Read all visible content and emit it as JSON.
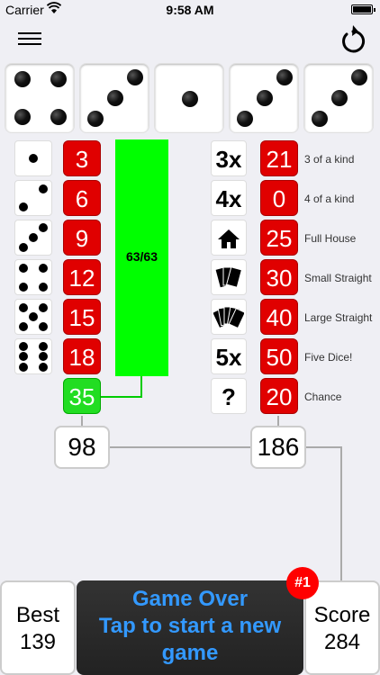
{
  "status": {
    "carrier": "Carrier",
    "time": "9:58 AM"
  },
  "upper": {
    "scores": [
      "3",
      "6",
      "9",
      "12",
      "15",
      "18"
    ],
    "bonus_progress": "63/63",
    "bonus": "35",
    "total": "98"
  },
  "lower": {
    "categories": [
      {
        "icon": "3x",
        "score": "21",
        "label": "3 of a kind"
      },
      {
        "icon": "4x",
        "score": "0",
        "label": "4 of a kind"
      },
      {
        "icon": "house-icon",
        "score": "25",
        "label": "Full House"
      },
      {
        "icon": "cards-small-icon",
        "score": "30",
        "label": "Small Straight"
      },
      {
        "icon": "cards-large-icon",
        "score": "40",
        "label": "Large Straight"
      },
      {
        "icon": "5x",
        "score": "50",
        "label": "Five Dice!"
      },
      {
        "icon": "?",
        "score": "20",
        "label": "Chance"
      }
    ],
    "total": "186"
  },
  "footer": {
    "best_label": "Best",
    "best_value": "139",
    "game_over_line1": "Game Over",
    "game_over_line2": "Tap to start a new game",
    "rank_badge": "#1",
    "score_label": "Score",
    "score_value": "284"
  },
  "dice": [
    4,
    3,
    1,
    3,
    3
  ],
  "colors": {
    "score_red": "#e00000",
    "bonus_green": "#22dd22",
    "bar_green": "#00ff00",
    "game_over_text": "#3399ff"
  }
}
